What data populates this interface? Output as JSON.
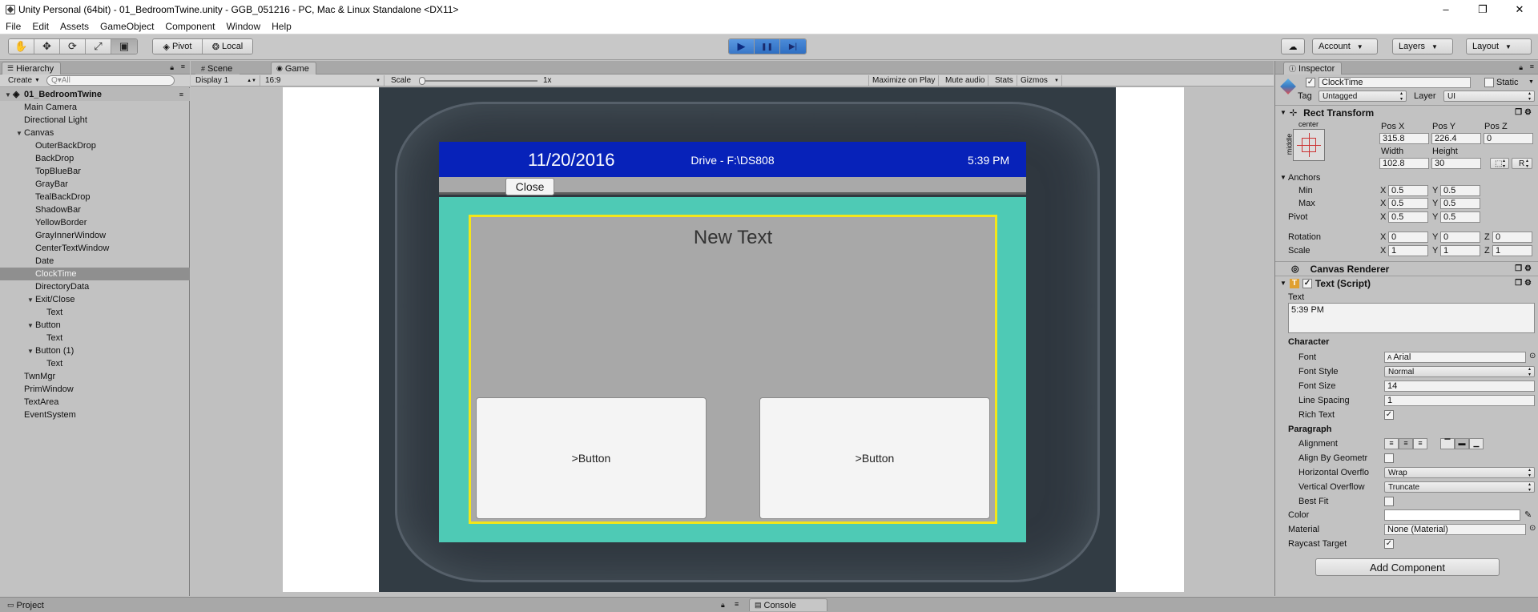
{
  "window": {
    "title": "Unity Personal (64bit) - 01_BedroomTwine.unity - GGB_051216 - PC, Mac & Linux Standalone <DX11>",
    "controls": [
      "–",
      "❐",
      "✕"
    ]
  },
  "menu": [
    "File",
    "Edit",
    "Assets",
    "GameObject",
    "Component",
    "Window",
    "Help"
  ],
  "toolbar": {
    "tools": [
      "hand-tool",
      "move-tool",
      "rotate-tool",
      "scale-tool",
      "rect-tool"
    ],
    "pivot_label": "Pivot",
    "local_label": "Local",
    "play": "▶",
    "pause": "❚❚",
    "step": "▶|",
    "account_label": "Account",
    "layers_label": "Layers",
    "layout_label": "Layout"
  },
  "hierarchy": {
    "tab": "Hierarchy",
    "create_label": "Create",
    "search_placeholder": "Q▾All",
    "scene": "01_BedroomTwine",
    "items": [
      {
        "label": "Main Camera",
        "indent": 1,
        "arrow": ""
      },
      {
        "label": "Directional Light",
        "indent": 1,
        "arrow": ""
      },
      {
        "label": "Canvas",
        "indent": 1,
        "arrow": "▼"
      },
      {
        "label": "OuterBackDrop",
        "indent": 2,
        "arrow": ""
      },
      {
        "label": "BackDrop",
        "indent": 2,
        "arrow": ""
      },
      {
        "label": "TopBlueBar",
        "indent": 2,
        "arrow": ""
      },
      {
        "label": "GrayBar",
        "indent": 2,
        "arrow": ""
      },
      {
        "label": "TealBackDrop",
        "indent": 2,
        "arrow": ""
      },
      {
        "label": "ShadowBar",
        "indent": 2,
        "arrow": ""
      },
      {
        "label": "YellowBorder",
        "indent": 2,
        "arrow": ""
      },
      {
        "label": "GrayInnerWindow",
        "indent": 2,
        "arrow": ""
      },
      {
        "label": "CenterTextWindow",
        "indent": 2,
        "arrow": ""
      },
      {
        "label": "Date",
        "indent": 2,
        "arrow": ""
      },
      {
        "label": "ClockTime",
        "indent": 2,
        "arrow": "",
        "selected": true
      },
      {
        "label": "DirectoryData",
        "indent": 2,
        "arrow": ""
      },
      {
        "label": "Exit/Close",
        "indent": 2,
        "arrow": "▼"
      },
      {
        "label": "Text",
        "indent": 3,
        "arrow": ""
      },
      {
        "label": "Button",
        "indent": 2,
        "arrow": "▼"
      },
      {
        "label": "Text",
        "indent": 3,
        "arrow": ""
      },
      {
        "label": "Button (1)",
        "indent": 2,
        "arrow": "▼"
      },
      {
        "label": "Text",
        "indent": 3,
        "arrow": ""
      },
      {
        "label": "TwnMgr",
        "indent": 1,
        "arrow": ""
      },
      {
        "label": "PrimWindow",
        "indent": 1,
        "arrow": ""
      },
      {
        "label": "TextArea",
        "indent": 1,
        "arrow": ""
      },
      {
        "label": "EventSystem",
        "indent": 1,
        "arrow": ""
      }
    ]
  },
  "game_view": {
    "tabs": [
      "Scene",
      "Game"
    ],
    "display": "Display 1",
    "aspect": "16:9",
    "scale_label": "Scale",
    "scale_value": "1x",
    "options": [
      "Maximize on Play",
      "Mute audio",
      "Stats",
      "Gizmos"
    ],
    "screen": {
      "date": "11/20/2016",
      "drive": "Drive - F:\\DS808",
      "time": "5:39 PM",
      "close_button": "Close",
      "center_text": "New Text",
      "button_left": ">Button",
      "button_right": ">Button"
    }
  },
  "inspector": {
    "tab": "Inspector",
    "object_name": "ClockTime",
    "static_label": "Static",
    "tag_label": "Tag",
    "tag_value": "Untagged",
    "layer_label": "Layer",
    "layer_value": "UI",
    "rect_transform": {
      "title": "Rect Transform",
      "anchor_preset_top": "center",
      "anchor_preset_side": "middle",
      "pos_x_label": "Pos X",
      "pos_x": "315.8",
      "pos_y_label": "Pos Y",
      "pos_y": "226.4",
      "pos_z_label": "Pos Z",
      "pos_z": "0",
      "width_label": "Width",
      "width": "102.8",
      "height_label": "Height",
      "height": "30",
      "r_label": "R",
      "anchors_label": "Anchors",
      "min_label": "Min",
      "min_x": "0.5",
      "min_y": "0.5",
      "max_label": "Max",
      "max_x": "0.5",
      "max_y": "0.5",
      "pivot_label": "Pivot",
      "pivot_x": "0.5",
      "pivot_y": "0.5",
      "rotation_label": "Rotation",
      "rot_x": "0",
      "rot_y": "0",
      "rot_z": "0",
      "scale_label": "Scale",
      "scale_x": "1",
      "scale_y": "1",
      "scale_z": "1",
      "x": "X",
      "y": "Y",
      "z": "Z"
    },
    "canvas_renderer": "Canvas Renderer",
    "text_script": {
      "title": "Text (Script)",
      "text_label": "Text",
      "text_value": "5:39 PM",
      "character_label": "Character",
      "font_label": "Font",
      "font_value": "Arial",
      "font_style_label": "Font Style",
      "font_style_value": "Normal",
      "font_size_label": "Font Size",
      "font_size_value": "14",
      "line_spacing_label": "Line Spacing",
      "line_spacing_value": "1",
      "rich_text_label": "Rich Text",
      "paragraph_label": "Paragraph",
      "alignment_label": "Alignment",
      "align_by_geometry_label": "Align By Geometr",
      "h_overflow_label": "Horizontal Overflo",
      "h_overflow_value": "Wrap",
      "v_overflow_label": "Vertical Overflow",
      "v_overflow_value": "Truncate",
      "best_fit_label": "Best Fit",
      "color_label": "Color",
      "material_label": "Material",
      "material_value": "None (Material)",
      "raycast_label": "Raycast Target"
    },
    "add_component": "Add Component"
  },
  "bottom": {
    "project_tab": "Project",
    "console_tab": "Console"
  }
}
